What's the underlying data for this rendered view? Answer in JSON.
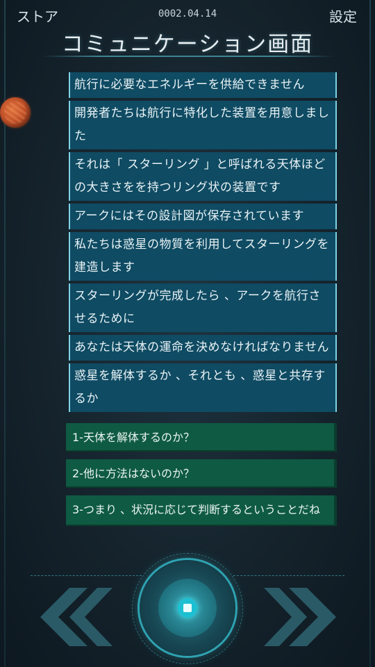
{
  "header": {
    "store_label": "ストア",
    "date": "0002.04.14",
    "settings_label": "設定",
    "title": "コミュニケーション画面"
  },
  "messages": [
    "航行に必要なエネルギーを供給できません",
    "開発者たちは航行に特化した装置を用意しました",
    "それは「 スターリング 」と呼ばれる天体ほどの大きさをを持つリング状の装置です",
    "アークにはその設計図が保存されています",
    "私たちは惑星の物質を利用してスターリングを建造します",
    "スターリングが完成したら 、アークを航行させるために",
    "あなたは天体の運命を決めなければなりません",
    "惑星を解体するか 、それとも 、惑星と共存するか"
  ],
  "choices": [
    "1-天体を解体するのか？",
    "2-他に方法はないのか？",
    "3-つまり 、状況に応じて判断するということだね"
  ],
  "controls": {
    "left_icon": "double-chevron-left-icon",
    "right_icon": "double-chevron-right-icon",
    "center_icon": "confirm-core-icon"
  },
  "colors": {
    "message_bg": "#0f4b63",
    "choice_bg": "#0f5a43",
    "accent": "#2fa3b2",
    "planet": "#c2522a"
  }
}
